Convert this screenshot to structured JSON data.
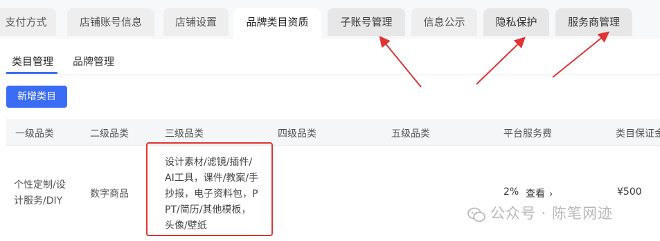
{
  "top_tabs": [
    {
      "label": "支付方式"
    },
    {
      "label": "店铺账号信息"
    },
    {
      "label": "店铺设置"
    },
    {
      "label": "品牌类目资质",
      "active": true
    },
    {
      "label": "子账号管理"
    },
    {
      "label": "信息公示"
    },
    {
      "label": "隐私保护"
    },
    {
      "label": "服务商管理"
    }
  ],
  "sub_tabs": [
    {
      "label": "类目管理",
      "active": true
    },
    {
      "label": "品牌管理"
    }
  ],
  "add_button": {
    "label": "新增类目"
  },
  "table": {
    "headers": [
      "一级品类",
      "二级品类",
      "三级品类",
      "四级品类",
      "五级品类",
      "平台服务费",
      "类目保证金"
    ],
    "rows": [
      {
        "level1": [
          "个性定制/设",
          "计服务/DIY"
        ],
        "level2": "数字商品",
        "level3": [
          "设计素材/滤镜/插件/",
          "AI工具，课件/教案/手",
          "抄报，电子资料包，P",
          "PT/简历/其他模板，",
          "头像/壁纸"
        ],
        "level4": "",
        "level5": "",
        "service_fee": "2%",
        "view_label": "查看",
        "deposit": "¥500"
      }
    ]
  },
  "watermark": {
    "text": "公众号 · 陈笔网迹"
  },
  "colors": {
    "accent": "#3a6cf5",
    "highlight": "#e23232"
  }
}
